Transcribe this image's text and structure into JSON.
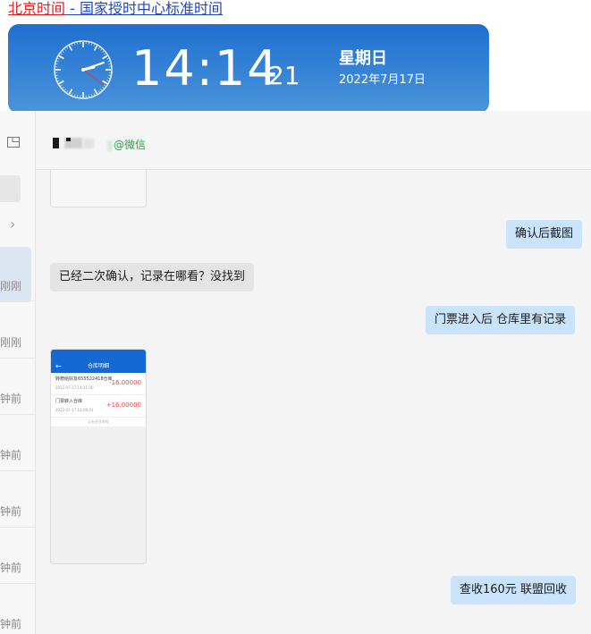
{
  "browser_link": {
    "part1": "北京时间",
    "part2": " - 国家授时中心标准时间"
  },
  "clock": {
    "hours_minutes": "14:14",
    "seconds": "21",
    "weekday": "星期日",
    "date": "2022年7月17日"
  },
  "sidebar": {
    "times": [
      "刚刚",
      "刚刚",
      "钟前",
      "钟前",
      "钟前",
      "钟前",
      "钟前"
    ]
  },
  "chat_header": {
    "tag": "@微信"
  },
  "messages": {
    "m1": "确认后截图",
    "m2": "已经二次确认，记录在哪看？没找到",
    "m3": "门票进入后   仓库里有记录",
    "m4": "查收160元   联盟回收"
  },
  "screenshot_image": {
    "title": "仓库明细",
    "rows": [
      {
        "label": "转赠给好友655522418仓库",
        "date": "2022-07-17 14:11:00",
        "amount": "-16.00000"
      },
      {
        "label": "门票转入仓库",
        "date": "2022-07-17 14:09:41",
        "amount": "+16.00000"
      }
    ],
    "footer": "没有更多数据"
  },
  "colors": {
    "clock_banner": "#2f80d5",
    "bubble_mine": "#c9e3fb",
    "bubble_theirs": "#e4e4e4",
    "wechat_tag": "#2aa244"
  }
}
